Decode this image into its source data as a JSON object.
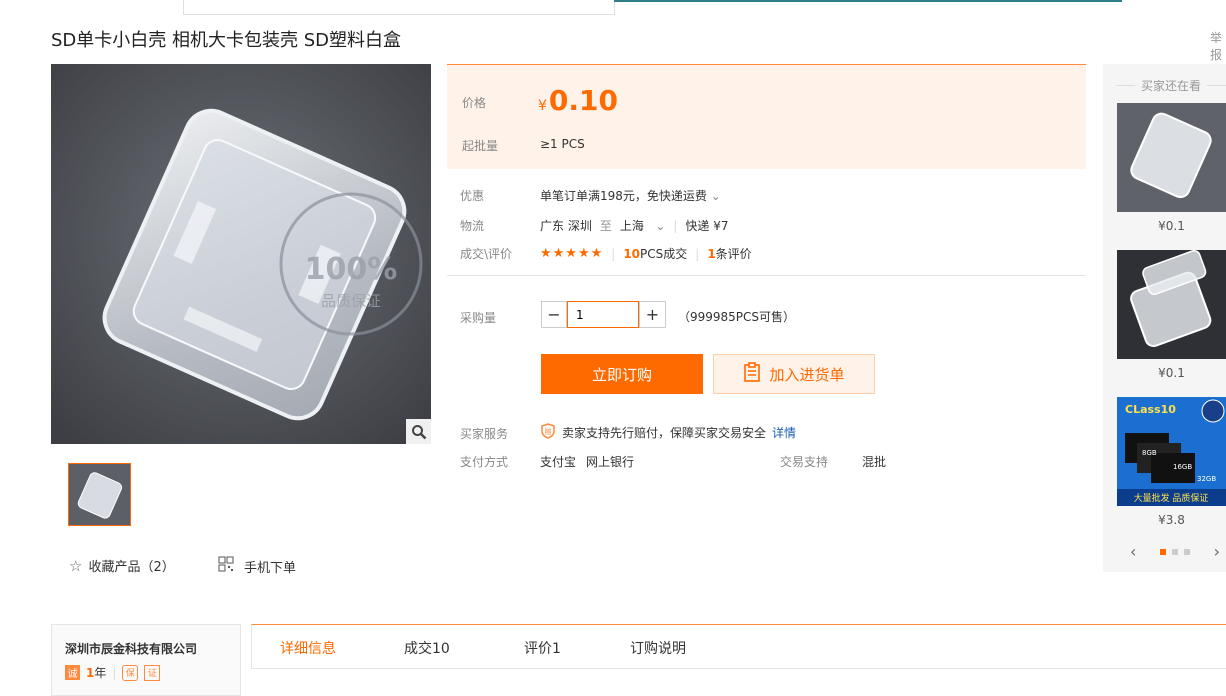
{
  "product": {
    "title": "SD单卡小白壳 相机大卡包装壳 SD塑料白盒",
    "report": "举报"
  },
  "gallery": {
    "zoom_icon": "magnifier-icon",
    "watermark_pct": "100%",
    "watermark_text": "品质保证"
  },
  "actions": {
    "favorite_label": "收藏产品（2）",
    "mobile_label": "手机下单"
  },
  "price": {
    "label": "价格",
    "currency": "¥",
    "value": "0.10",
    "moq_label": "起批量",
    "moq": "≥1  PCS"
  },
  "promo": {
    "label": "优惠",
    "text": "单笔订单满198元，免快递运费"
  },
  "shipping": {
    "label": "物流",
    "from": "广东 深圳",
    "to_word": "至",
    "to": "上海",
    "method": "快递 ¥7"
  },
  "deals": {
    "label": "成交\\评价",
    "stars": "★★★★★",
    "sold_count": "10",
    "sold_suffix": "PCS成交",
    "review_count": "1",
    "review_suffix": "条评价"
  },
  "quantity": {
    "label": "采购量",
    "minus": "−",
    "value": "1",
    "plus": "+",
    "stock": "（999985PCS可售）"
  },
  "buttons": {
    "buy": "立即订购",
    "cart": "加入进货单"
  },
  "service": {
    "label": "买家服务",
    "text": "卖家支持先行赔付，保障买家交易安全",
    "link": "详情"
  },
  "payment": {
    "label": "支付方式",
    "methods": [
      "支付宝",
      "网上银行"
    ],
    "trade_label": "交易支持",
    "trade_value": "混批"
  },
  "sidebar": {
    "title": "买家还在看",
    "items": [
      {
        "price": "¥0.1"
      },
      {
        "price": "¥0.1"
      },
      {
        "price": "¥3.8",
        "banner_top": "CLass10",
        "banner_bottom": "大量批发 品质保证",
        "sizes": [
          "8GB",
          "16GB",
          "32GB"
        ]
      }
    ]
  },
  "company": {
    "name": "深圳市辰金科技有限公司",
    "years_num": "1",
    "years_suffix": "年"
  },
  "tabs": [
    "详细信息",
    "成交10",
    "评价1",
    "订购说明"
  ],
  "colors": {
    "accent": "#ff6a00",
    "price_bg": "#fff2e8",
    "link": "#1a5fb4"
  }
}
